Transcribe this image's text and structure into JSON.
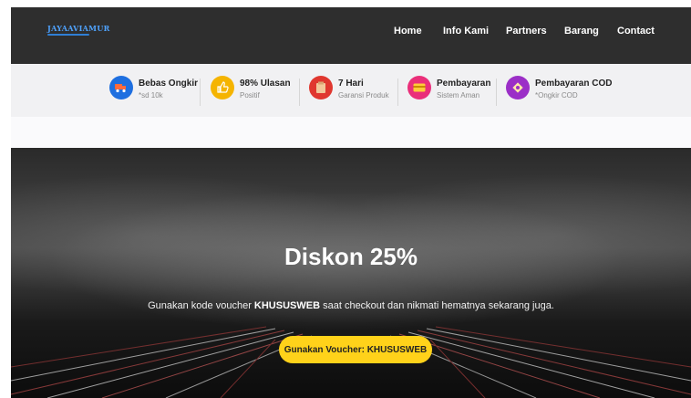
{
  "navbar": {
    "logo_text": "JAYAAVIAMUR",
    "items": [
      {
        "label": "Home"
      },
      {
        "label": "Info Kami"
      },
      {
        "label": "Partners"
      },
      {
        "label": "Barang"
      },
      {
        "label": "Contact"
      }
    ]
  },
  "features": [
    {
      "title": "Bebas Ongkir",
      "subtitle": "*sd 10k",
      "icon": "truck-icon",
      "color": "#1e6fe0"
    },
    {
      "title": "98% Ulasan",
      "subtitle": "Positif",
      "icon": "thumbs-up-icon",
      "color": "#f5b400"
    },
    {
      "title": "7 Hari",
      "subtitle": "Garansi Produk",
      "icon": "box-icon",
      "color": "#e0372f"
    },
    {
      "title": "Pembayaran",
      "subtitle": "Sistem Aman",
      "icon": "credit-card-icon",
      "color": "#ea2f7a"
    },
    {
      "title": "Pembayaran COD",
      "subtitle": "*Ongkir COD",
      "icon": "cash-icon",
      "color": "#9b2fc7"
    }
  ],
  "hero": {
    "title": "Diskon 25%",
    "subtitle_before": "Gunakan kode voucher ",
    "subtitle_code": "KHUSUSWEB",
    "subtitle_after": " saat checkout dan nikmati hematnya sekarang juga.",
    "cta_label": "Gunakan Voucher: KHUSUSWEB",
    "cta_color": "#ffd21a"
  }
}
